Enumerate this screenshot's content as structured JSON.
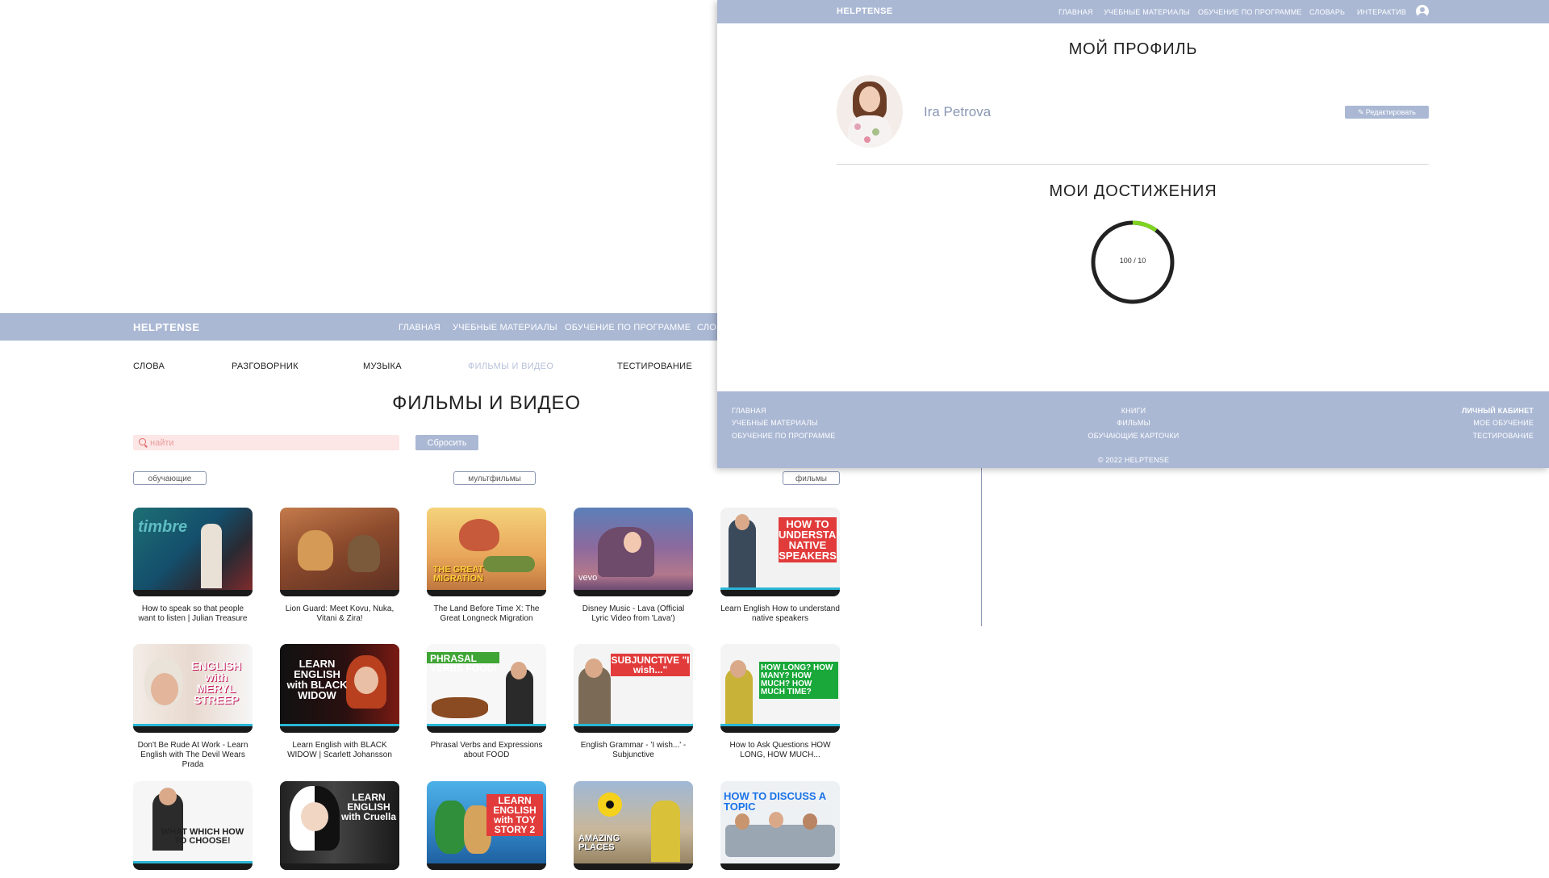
{
  "films_page": {
    "brand": "HELPTENSE",
    "nav": [
      "ГЛАВНАЯ",
      "УЧЕБНЫЕ МАТЕРИАЛЫ",
      "ОБУЧЕНИЕ ПО ПРОГРАММЕ",
      "СЛО"
    ],
    "subnav": [
      "СЛОВА",
      "РАЗГОВОРНИК",
      "МУЗЫКА",
      "ФИЛЬМЫ И ВИДЕО",
      "ТЕСТИРОВАНИЕ"
    ],
    "active_subnav": "ФИЛЬМЫ И ВИДЕО",
    "title": "ФИЛЬМЫ И ВИДЕО",
    "search": {
      "placeholder": "найти",
      "value": ""
    },
    "reset_label": "Сбросить",
    "filters": [
      "обучающие",
      "мультфильмы",
      "фильмы"
    ],
    "videos": [
      {
        "title": "How to speak so that people want to listen | Julian Treasure",
        "thumb_text": "timbre"
      },
      {
        "title": "Lion Guard: Meet Kovu, Nuka, Vitani & Zira!",
        "thumb_text": ""
      },
      {
        "title": "The Land Before Time X: The Great Longneck Migration",
        "thumb_text": "THE GREAT MIGRATION"
      },
      {
        "title": "Disney Music - Lava (Official Lyric Video from 'Lava')",
        "thumb_text": "vevo"
      },
      {
        "title": "Learn English How to understand native speakers",
        "thumb_text": "HOW TO UNDERSTAND NATIVE SPEAKERS"
      },
      {
        "title": "Don't Be Rude At Work - Learn English with The Devil Wears Prada",
        "thumb_text": "ENGLISH with MERYL STREEP"
      },
      {
        "title": "Learn English with BLACK WIDOW | Scarlett Johansson",
        "thumb_text": "LEARN ENGLISH with BLACK WIDOW"
      },
      {
        "title": "Phrasal Verbs and Expressions about FOOD",
        "thumb_text": "PHRASAL VERBS FOOD!"
      },
      {
        "title": "English Grammar - 'I wish...' - Subjunctive",
        "thumb_text": "SUBJUNCTIVE \"I wish...\""
      },
      {
        "title": "How to Ask Questions HOW LONG, HOW MUCH...",
        "thumb_text": "HOW LONG? HOW MANY? HOW MUCH? HOW MUCH TIME?"
      },
      {
        "title": "",
        "thumb_text": "WHAT WHICH HOW TO CHOOSE!"
      },
      {
        "title": "",
        "thumb_text": "LEARN ENGLISH with Cruella"
      },
      {
        "title": "",
        "thumb_text": "LEARN ENGLISH with TOY STORY 2"
      },
      {
        "title": "",
        "thumb_text": "AMAZING PLACES"
      },
      {
        "title": "",
        "thumb_text": "HOW TO DISCUSS A TOPIC"
      }
    ]
  },
  "profile_page": {
    "brand": "HELPTENSE",
    "nav": [
      "ГЛАВНАЯ",
      "УЧЕБНЫЕ МАТЕРИАЛЫ",
      "ОБУЧЕНИЕ ПО ПРОГРАММЕ",
      "СЛОВАРЬ",
      "ИНТЕРАКТИВ"
    ],
    "title": "МОЙ ПРОФИЛЬ",
    "user_name": "Ira Petrova",
    "edit_label": "Редактировать",
    "achievements_title": "МОИ ДОСТИЖЕНИЯ",
    "progress": {
      "label": "100 / 10",
      "fraction": 0.1,
      "track_color": "#222222",
      "fill_color": "#7ed321"
    },
    "footer": {
      "col1": [
        "ГЛАВНАЯ",
        "УЧЕБНЫЕ МАТЕРИАЛЫ",
        "ОБУЧЕНИЕ ПО ПРОГРАММЕ"
      ],
      "col2": [
        "КНИГИ",
        "ФИЛЬМЫ",
        "ОБУЧАЮЩИЕ КАРТОЧКИ"
      ],
      "col3": [
        "ЛИЧНЫЙ КАБИНЕТ",
        "МОЕ ОБУЧЕНИЕ",
        "ТЕСТИРОВАНИЕ"
      ],
      "copyright": "© 2022 HELPTENSE"
    }
  },
  "colors": {
    "nav_bg": "#aab8d4",
    "accent_text": "#8a96b3",
    "search_bg": "#fde6e6",
    "search_text": "#e36a6a"
  }
}
